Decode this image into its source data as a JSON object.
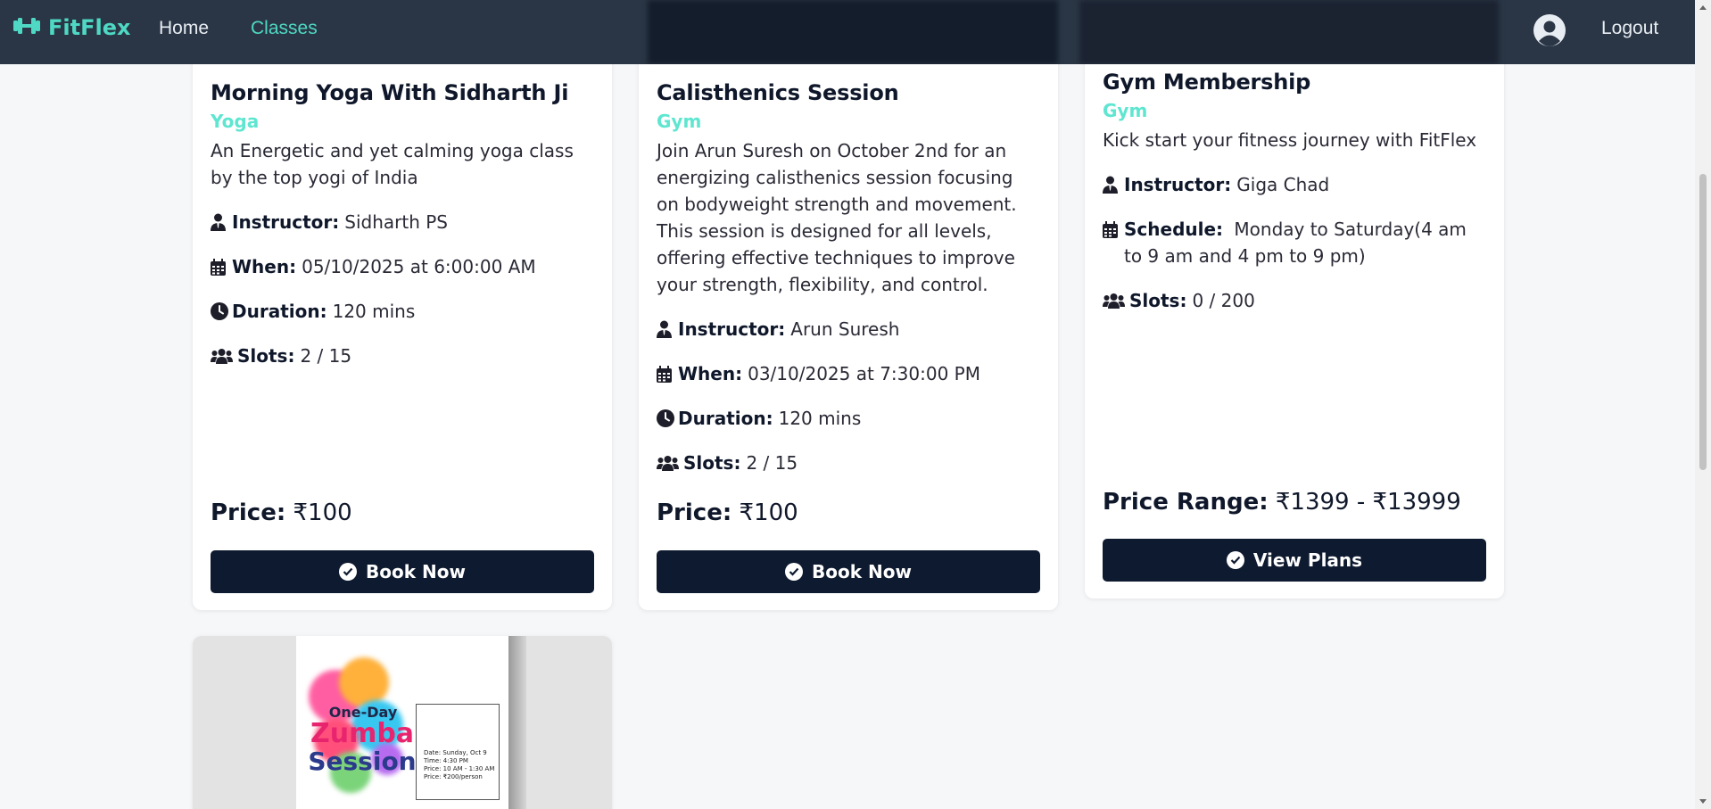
{
  "nav": {
    "brand": "FitFlex",
    "links": [
      {
        "label": "Home",
        "active": false
      },
      {
        "label": "Classes",
        "active": true
      }
    ],
    "logout_label": "Logout"
  },
  "colors": {
    "accent": "#4fd8c4",
    "navbar_bg": "#2a3645",
    "button_bg": "#0e1a2f",
    "category": "#5ee6d0"
  },
  "cards": [
    {
      "title": "Morning Yoga With Sidharth Ji",
      "category": "Yoga",
      "description": "An Energetic and yet calming yoga class by the top yogi of India",
      "instructor_label": "Instructor:",
      "instructor": "Sidharth PS",
      "when_label": "When:",
      "when": "05/10/2025 at 6:00:00 AM",
      "duration_label": "Duration:",
      "duration": "120 mins",
      "slots_label": "Slots:",
      "slots": "2 / 15",
      "price_label": "Price:",
      "price": "₹100",
      "button": "Book Now"
    },
    {
      "title": "Calisthenics Session",
      "category": "Gym",
      "description": "Join Arun Suresh on October 2nd for an energizing calisthenics session focusing on bodyweight strength and movement. This session is designed for all levels, offering effective techniques to improve your strength, flexibility, and control.",
      "instructor_label": "Instructor:",
      "instructor": "Arun Suresh",
      "when_label": "When:",
      "when": "03/10/2025 at 7:30:00 PM",
      "duration_label": "Duration:",
      "duration": "120 mins",
      "slots_label": "Slots:",
      "slots": "2 / 15",
      "price_label": "Price:",
      "price": "₹100",
      "button": "Book Now"
    },
    {
      "title": "Gym Membership",
      "category": "Gym",
      "description": "Kick start your fitness journey with FitFlex",
      "instructor_label": "Instructor:",
      "instructor": "Giga Chad",
      "schedule_label": "Schedule:",
      "schedule": "Monday to Saturday(4 am to 9 am and 4 pm to 9 pm)",
      "slots_label": "Slots:",
      "slots": "0 / 200",
      "price_label": "Price Range:",
      "price": "₹1399 - ₹13999",
      "button": "View Plans"
    }
  ],
  "zumba_poster": {
    "line1": "One-Day",
    "line2": "Zumba",
    "line3": "Session",
    "details": [
      "Date: Sunday, Oct 9",
      "Time: 4:30 PM",
      "Price: 10 AM - 1:30 AM",
      "Price: ₹200/person"
    ]
  },
  "icons": {
    "logo": "dumbbell-icon",
    "avatar": "user-circle-icon",
    "instructor": "user-tie-icon",
    "when": "calendar-icon",
    "duration": "clock-icon",
    "slots": "users-icon",
    "button": "check-circle-icon"
  }
}
